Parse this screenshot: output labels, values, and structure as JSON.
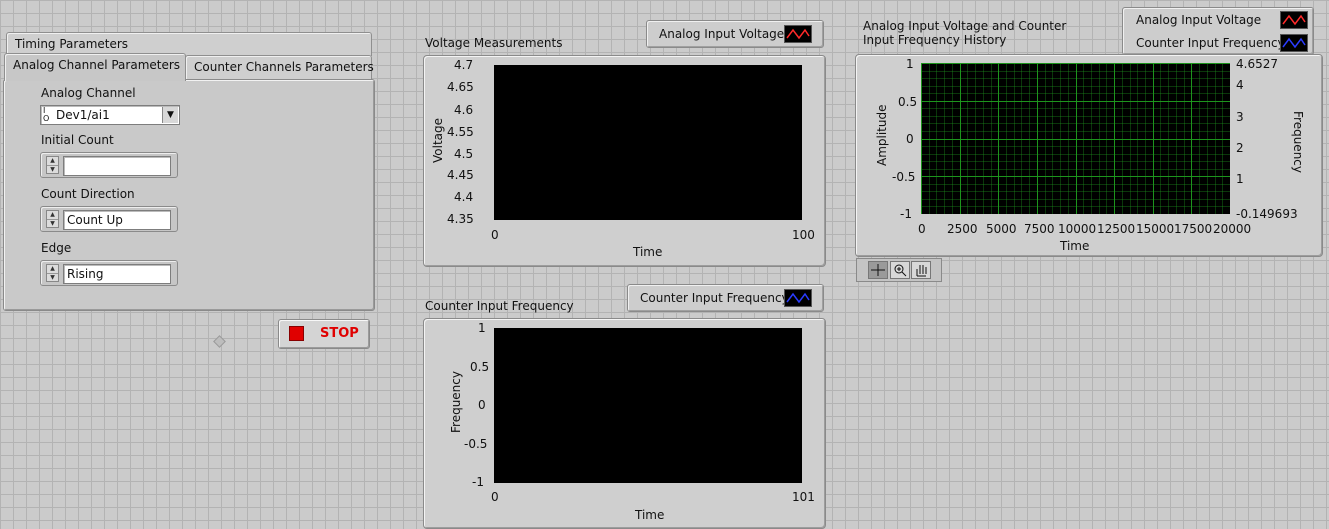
{
  "tabs": {
    "timing": "Timing Parameters",
    "analog": "Analog Channel Parameters",
    "counter": "Counter Channels Parameters"
  },
  "analog_panel": {
    "channel_label": "Analog Channel",
    "channel_value": "Dev1/ai1",
    "channel_prefix": "I/O",
    "initial_count_label": "Initial Count",
    "initial_count_value": "",
    "count_direction_label": "Count Direction",
    "count_direction_value": "Count Up",
    "edge_label": "Edge",
    "edge_value": "Rising"
  },
  "stop_button": {
    "label": "STOP",
    "color": "#e00000"
  },
  "voltage_graph": {
    "title": "Voltage Measurements",
    "legend": "Analog Input Voltage",
    "legend_color": "#ff2a2a",
    "y_ticks": [
      "4.7",
      "4.65",
      "4.6",
      "4.55",
      "4.5",
      "4.45",
      "4.4",
      "4.35"
    ],
    "x_ticks": [
      "0",
      "100"
    ],
    "ylabel": "Voltage",
    "xlabel": "Time"
  },
  "counter_graph": {
    "title": "Counter Input Frequency",
    "legend": "Counter Input Frequency",
    "legend_color": "#2a3cff",
    "y_ticks": [
      "1",
      "0.5",
      "0",
      "-0.5",
      "-1"
    ],
    "x_ticks": [
      "0",
      "101"
    ],
    "ylabel": "Frequency",
    "xlabel": "Time"
  },
  "history_chart": {
    "title_line1": "Analog Input Voltage and Counter",
    "title_line2": "Input Frequency History",
    "legend": [
      {
        "label": "Analog Input Voltage",
        "color": "#ff2a2a"
      },
      {
        "label": "Counter Input Frequency",
        "color": "#2a3cff"
      }
    ],
    "y_left_ticks": [
      "1",
      "0.5",
      "0",
      "-0.5",
      "-1"
    ],
    "y_right_ticks": [
      "4.6527",
      "4",
      "3",
      "2",
      "1",
      "-0.149693"
    ],
    "x_ticks": [
      "0",
      "2500",
      "5000",
      "7500",
      "10000",
      "12500",
      "15000",
      "17500",
      "20000"
    ],
    "ylabel_left": "Amplitude",
    "ylabel_right": "Frequency",
    "xlabel": "Time",
    "grid_color": "#1f9a1f"
  },
  "palette_tools": [
    "crosshair-icon",
    "zoom-icon",
    "pan-hand-icon"
  ]
}
